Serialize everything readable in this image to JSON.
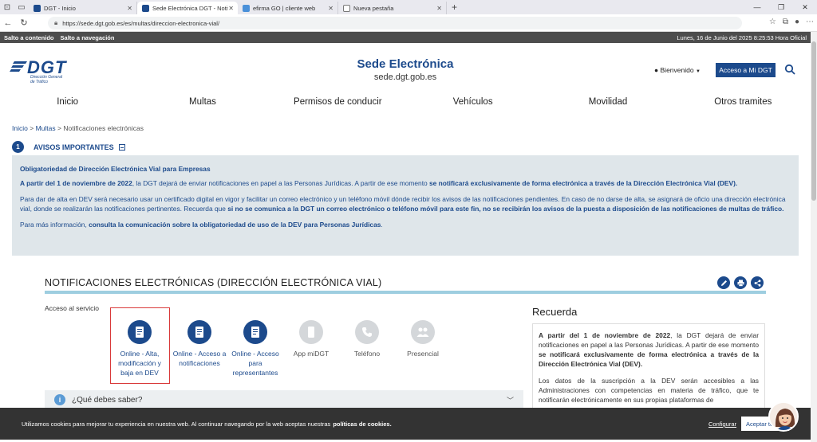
{
  "browser": {
    "tabs": [
      {
        "label": "DGT - Inicio",
        "color": "#1c4a8c"
      },
      {
        "label": "Sede Electrónica DGT - Notificaci",
        "color": "#1c4a8c"
      },
      {
        "label": "efirma GO | cliente web",
        "color": "#4a90d9"
      },
      {
        "label": "Nueva pestaña",
        "color": "#777777"
      }
    ],
    "url": "https://sede.dgt.gob.es/es/multas/direccion-electronica-vial/"
  },
  "skip": {
    "content": "Salto a contenido",
    "nav": "Salto a navegación",
    "date": "Lunes, 16 de Junio del 2025 8:25:53 Hora Oficial"
  },
  "header": {
    "logo": "DGT",
    "logo_sub_1": "Dirección General",
    "logo_sub_2": "de Tráfico",
    "title": "Sede Electrónica",
    "subtitle": "sede.dgt.gob.es",
    "welcome": "Bienvenido",
    "access": "Acceso a Mi DGT"
  },
  "nav": [
    "Inicio",
    "Multas",
    "Permisos de conducir",
    "Vehículos",
    "Movilidad",
    "Otros tramites"
  ],
  "breadcrumb": {
    "home": "Inicio",
    "sep": ">",
    "multas": "Multas",
    "current": "Notificaciones electrónicas"
  },
  "avisos": {
    "num": "1",
    "label": "AVISOS IMPORTANTES"
  },
  "info": {
    "heading": "Obligatoriedad de Dirección Electrónica Vial para Empresas",
    "p1a": "A partir del 1 de noviembre de 2022",
    "p1b": ", la DGT dejará de enviar notificaciones en papel a las Personas Jurídicas. A partir de ese momento ",
    "p1c": "se notificará exclusivamente de forma electrónica a través de la Dirección Electrónica Vial (DEV).",
    "p2a": "Para dar de alta en DEV será necesario usar un certificado digital en vigor y facilitar un correo electrónico y un teléfono móvil dónde recibir los avisos de las notificaciones pendientes. En caso de no darse de alta, se asignará de oficio una dirección electrónica vial, donde se realizarán las notificaciones pertinentes. Recuerda que ",
    "p2b": "si no se comunica a la DGT un correo electrónico o teléfono móvil para este fin, no se recibirán los avisos de la puesta a disposición de las notificaciones de multas de tráfico.",
    "p3a": "Para más información, ",
    "p3b": "consulta la comunicación sobre la obligatoriedad de uso de la DEV para Personas Jurídicas",
    "p3c": "."
  },
  "section": {
    "title": "NOTIFICACIONES ELECTRÓNICAS (DIRECCIÓN ELECTRÓNICA VIAL)",
    "acceso": "Acceso al servicio"
  },
  "services": [
    {
      "label": "Online - Alta, modificación y baja en DEV",
      "active": true
    },
    {
      "label": "Online - Acceso a notificaciones",
      "active": true
    },
    {
      "label": "Online - Acceso para representantes",
      "active": true
    },
    {
      "label": "App miDGT",
      "active": false
    },
    {
      "label": "Teléfono",
      "active": false
    },
    {
      "label": "Presencial",
      "active": false
    }
  ],
  "recuerda": {
    "title": "Recuerda",
    "p1a": "A partir del 1 de noviembre de 2022",
    "p1b": ", la DGT dejará de enviar notificaciones en papel a las Personas Jurídicas. A partir de ese momento ",
    "p1c": "se notificará exclusivamente de forma electrónica a través de la Dirección Electrónica Vial (DEV).",
    "p2": "Los datos de la suscripción a la DEV serán accesibles a las Administraciones con competencias en materia de tráfico, que te notificarán electrónicamente en sus propias plataformas de"
  },
  "faq": {
    "label": "¿Qué debes saber?"
  },
  "cookies": {
    "text": "Utilizamos cookies para mejorar tu experiencia en nuestra web. Al continuar navegando por la web aceptas nuestras",
    "link": "políticas de cookies.",
    "config": "Configurar",
    "accept": "Aceptar to"
  },
  "colors": {
    "brand": "#1c4a8c",
    "highlight": "#d93a3a",
    "info_bg": "#dfe6ea",
    "section_line": "#9ecee0"
  }
}
